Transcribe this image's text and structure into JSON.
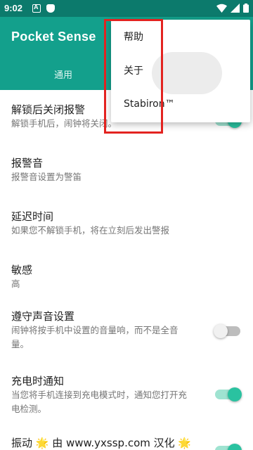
{
  "status_bar": {
    "time": "9:02"
  },
  "app": {
    "title": "Pocket Sense",
    "tabs": [
      {
        "label": "通用"
      }
    ]
  },
  "settings": [
    {
      "title": "解锁后关闭报警",
      "subtitle": "解锁手机后，闹钟将关闭。",
      "toggle": "on"
    },
    {
      "title": "报警音",
      "subtitle": "报警音设置为警笛"
    },
    {
      "title": "延迟时间",
      "subtitle": "如果您不解锁手机，将在立刻后发出警报"
    },
    {
      "title": "敏感",
      "subtitle": "高"
    },
    {
      "title": "遵守声音设置",
      "subtitle": "闹钟将按手机中设置的音量响，而不是全音量。",
      "toggle": "off"
    },
    {
      "title": "充电时通知",
      "subtitle": "当您将手机连接到充电模式时，通知您打开充电检测。",
      "toggle": "on"
    },
    {
      "title": "振动 🌟 由 www.yxssp.com 汉化 🌟",
      "toggle": "on"
    }
  ],
  "overflow_menu": {
    "items": [
      {
        "label": "帮助"
      },
      {
        "label": "关于"
      },
      {
        "label": "Stabiron™"
      }
    ]
  },
  "colors": {
    "status_bar": "#0c7a6c",
    "app_bar": "#13a08c",
    "switch_on_knob": "#2ac2a0",
    "switch_on_track": "#9fe3d1",
    "highlight_box": "#e32320"
  },
  "icons": [
    "a-icon",
    "cat-icon",
    "wifi-icon",
    "cellular-signal-icon",
    "battery-icon"
  ]
}
